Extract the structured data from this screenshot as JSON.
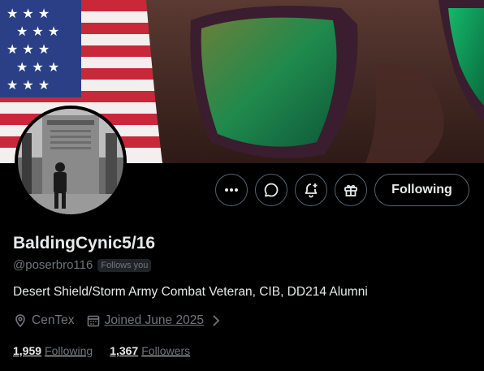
{
  "profile": {
    "display_name": "BaldingCynic5/16",
    "handle": "@poserbro116",
    "follows_you_label": "Follows you",
    "bio": "Desert Shield/Storm Army Combat Veteran, CIB, DD214 Alumni",
    "location": "CenTex",
    "joined": "Joined June 2025"
  },
  "actions": {
    "follow_label": "Following",
    "icons": [
      "more-icon",
      "message-icon",
      "notification-add-icon",
      "gift-icon"
    ]
  },
  "stats": {
    "following_count": "1,959",
    "following_label": "Following",
    "followers_count": "1,367",
    "followers_label": "Followers"
  },
  "colors": {
    "background": "#000000",
    "text_primary": "#e7e9ea",
    "text_secondary": "#71767b",
    "button_border": "#536471"
  }
}
